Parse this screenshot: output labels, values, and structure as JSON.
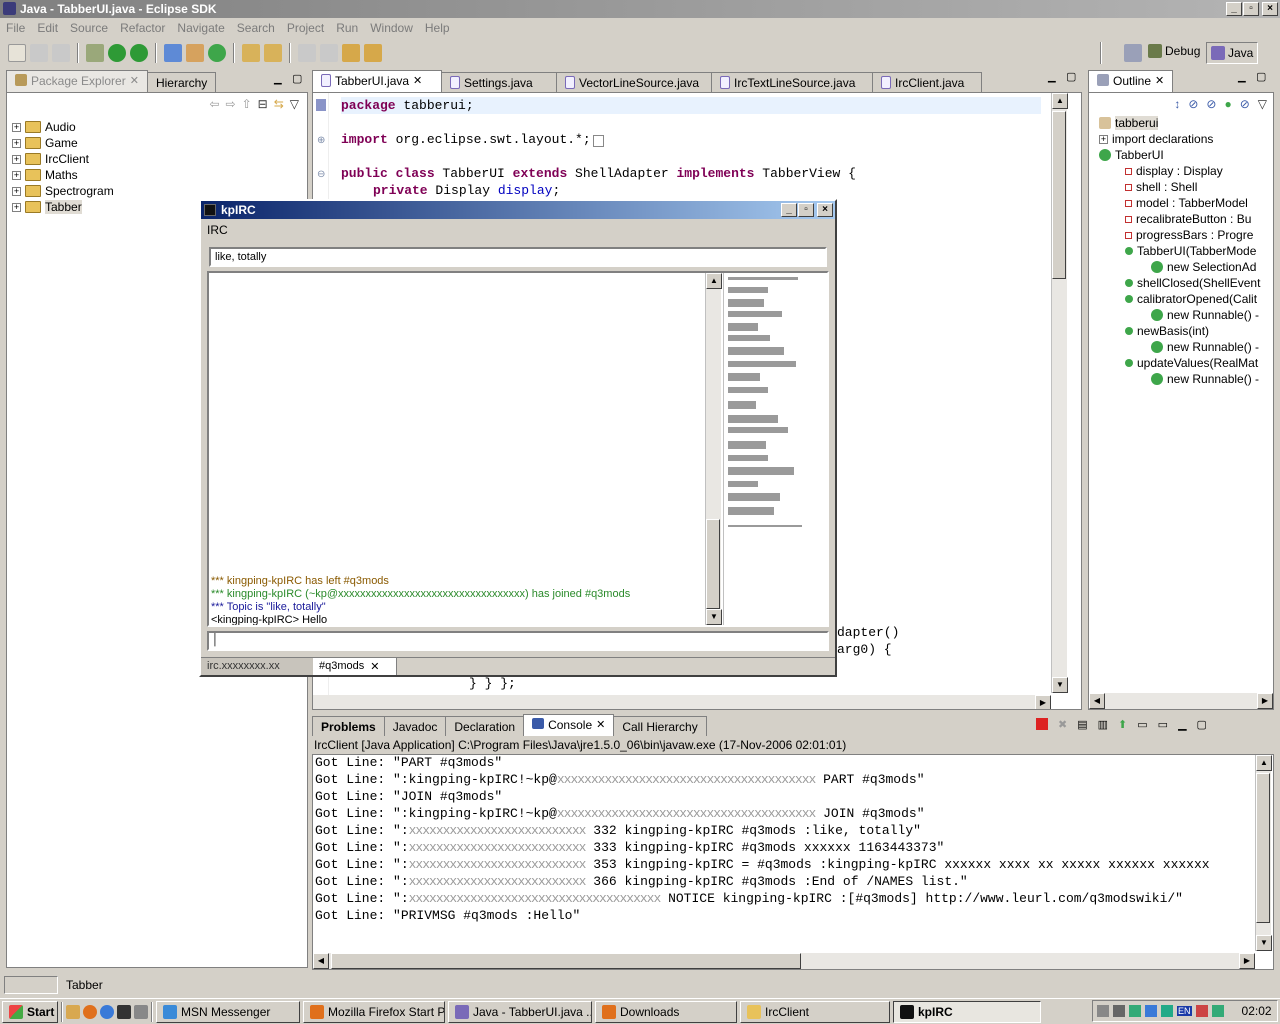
{
  "window": {
    "title": "Java - TabberUI.java - Eclipse SDK"
  },
  "menu": [
    "File",
    "Edit",
    "Source",
    "Refactor",
    "Navigate",
    "Search",
    "Project",
    "Run",
    "Window",
    "Help"
  ],
  "perspectives": {
    "debug": "Debug",
    "java": "Java"
  },
  "left_panel": {
    "tabs": [
      "Package Explorer",
      "Hierarchy"
    ],
    "items": [
      "Audio",
      "Game",
      "IrcClient",
      "Maths",
      "Spectrogram",
      "Tabber"
    ]
  },
  "editor": {
    "tabs": [
      "TabberUI.java",
      "Settings.java",
      "VectorLineSource.java",
      "IrcTextLineSource.java",
      "IrcClient.java"
    ],
    "code_top": [
      {
        "kw": "package",
        "rest": " tabberui;"
      },
      {
        "kw": "import",
        "rest": " org.eclipse.swt.layout.*;"
      },
      {
        "kw": "public class",
        "rest": " TabberUI ",
        "kw2": "extends",
        "rest2": " ShellAdapter ",
        "kw3": "implements",
        "rest3": " TabberView {"
      },
      {
        "kw": "private",
        "rest": " Display ",
        "field": "display",
        "rest2": ";"
      }
    ],
    "code_bottom": [
      "dapter()",
      "arg0) {",
      "} } };"
    ]
  },
  "outline": {
    "tab": "Outline",
    "items": [
      {
        "label": "tabberui",
        "indent": 0
      },
      {
        "label": "import declarations",
        "indent": 0
      },
      {
        "label": "TabberUI",
        "indent": 0
      },
      {
        "label": "display : Display",
        "indent": 1
      },
      {
        "label": "shell : Shell",
        "indent": 1
      },
      {
        "label": "model : TabberModel",
        "indent": 1
      },
      {
        "label": "recalibrateButton : Bu",
        "indent": 1
      },
      {
        "label": "progressBars : Progre",
        "indent": 1
      },
      {
        "label": "TabberUI(TabberMode",
        "indent": 1
      },
      {
        "label": "new SelectionAd",
        "indent": 2
      },
      {
        "label": "shellClosed(ShellEvent",
        "indent": 1
      },
      {
        "label": "calibratorOpened(Calit",
        "indent": 1
      },
      {
        "label": "new Runnable() -",
        "indent": 2
      },
      {
        "label": "newBasis(int)",
        "indent": 1
      },
      {
        "label": "new Runnable() -",
        "indent": 2
      },
      {
        "label": "updateValues(RealMat",
        "indent": 1
      },
      {
        "label": "new Runnable() -",
        "indent": 2
      }
    ]
  },
  "bottom_panel": {
    "tabs": [
      "Problems",
      "Javadoc",
      "Declaration",
      "Console",
      "Call Hierarchy"
    ],
    "console_header": "IrcClient [Java Application] C:\\Program Files\\Java\\jre1.5.0_06\\bin\\javaw.exe (17-Nov-2006 02:01:01)",
    "lines": [
      {
        "a": "Got Line: \"PART #q3mods\"",
        "b": "",
        "c": ""
      },
      {
        "a": "Got Line: \":kingping-kpIRC!~kp@",
        "b": "xxxxxxxxxxxxxxxxxxxxxxxxxxxxxxxxxxxxxx",
        "c": " PART #q3mods\""
      },
      {
        "a": "Got Line: \"JOIN #q3mods\"",
        "b": "",
        "c": ""
      },
      {
        "a": "Got Line: \":kingping-kpIRC!~kp@",
        "b": "xxxxxxxxxxxxxxxxxxxxxxxxxxxxxxxxxxxxxx",
        "c": " JOIN #q3mods\""
      },
      {
        "a": "Got Line: \":",
        "b": "xxxxxxxxxxxxxxxxxxxxxxxxxx",
        "c": " 332 kingping-kpIRC #q3mods :like, totally\""
      },
      {
        "a": "Got Line: \":",
        "b": "xxxxxxxxxxxxxxxxxxxxxxxxxx",
        "c": " 333 kingping-kpIRC #q3mods xxxxxx 1163443373\""
      },
      {
        "a": "Got Line: \":",
        "b": "xxxxxxxxxxxxxxxxxxxxxxxxxx",
        "c": " 353 kingping-kpIRC = #q3mods :kingping-kpIRC xxxxxx xxxx xx xxxxx xxxxxx xxxxxx"
      },
      {
        "a": "Got Line: \":",
        "b": "xxxxxxxxxxxxxxxxxxxxxxxxxx",
        "c": " 366 kingping-kpIRC #q3mods :End of /NAMES list.\""
      },
      {
        "a": "Got Line: \":",
        "b": "xxxxxxxxxxxxxxxxxxxxxxxxxxxxxxxxxxxxx",
        "c": " NOTICE kingping-kpIRC :[#q3mods] http://www.leurl.com/q3modswiki/\""
      },
      {
        "a": "Got Line: \"PRIVMSG #q3mods :Hello\"",
        "b": "",
        "c": ""
      }
    ]
  },
  "status_bar": {
    "text": "Tabber"
  },
  "irc_window": {
    "title": "kpIRC",
    "menu": "IRC",
    "topic": "like, totally",
    "messages": [
      {
        "text": "*** kingping-kpIRC has left #q3mods",
        "color": "#8a5a00"
      },
      {
        "text": "*** kingping-kpIRC (~kp@xxxxxxxxxxxxxxxxxxxxxxxxxxxxxxxxxx) has joined #q3mods",
        "color": "#2a8a2a"
      },
      {
        "text": "*** Topic is \"like, totally\"",
        "color": "#1a1a9a"
      },
      {
        "text": "<kingping-kpIRC> Hello",
        "color": "#000000"
      }
    ],
    "tabs": [
      "irc.xxxxxxxx.xx",
      "#q3mods"
    ]
  },
  "taskbar": {
    "start": "Start",
    "tasks": [
      "MSN Messenger",
      "Mozilla Firefox Start P...",
      "Java - TabberUI.java ...",
      "Downloads",
      "IrcClient",
      "kpIRC"
    ],
    "clock": "02:02",
    "lang": "EN"
  }
}
